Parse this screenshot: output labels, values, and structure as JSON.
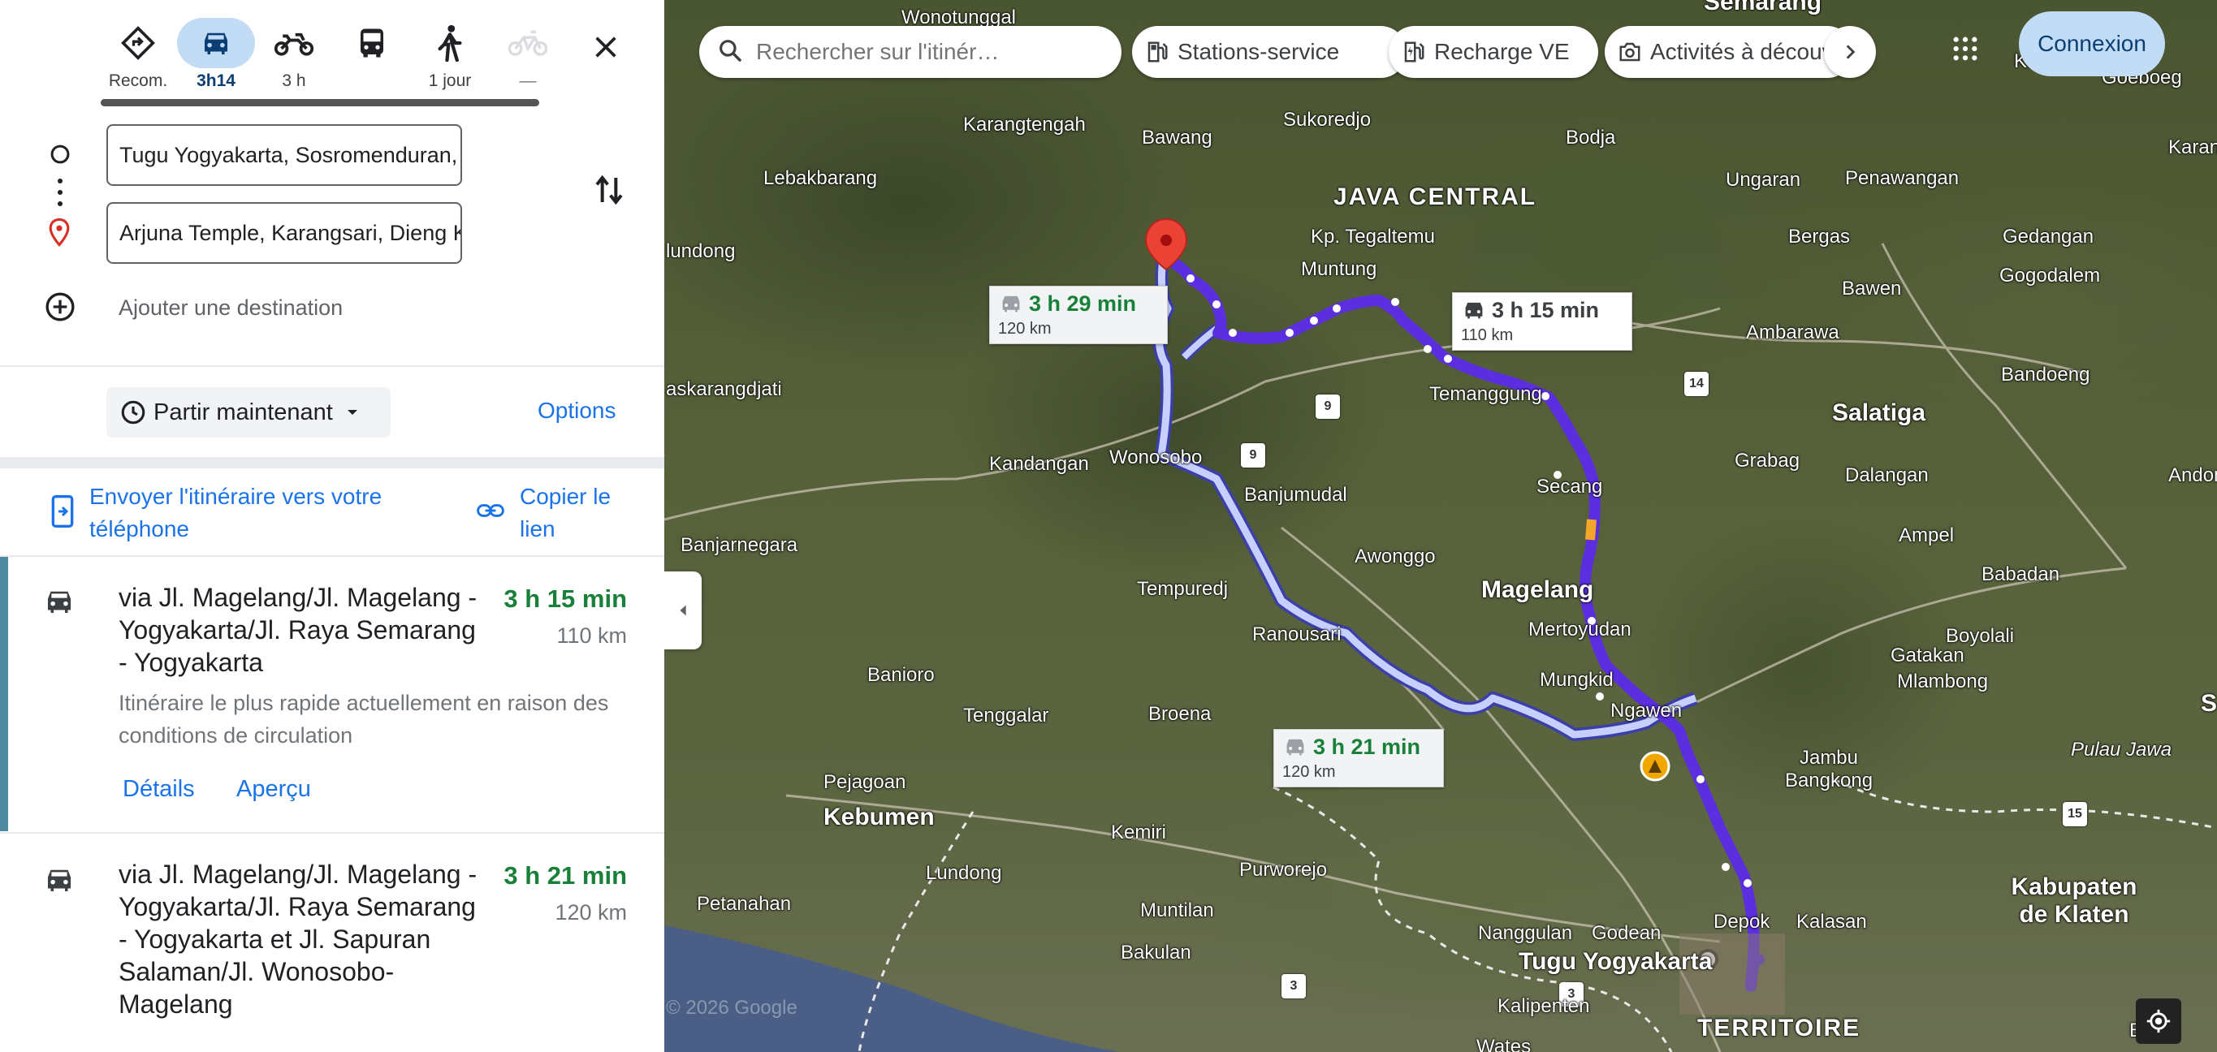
{
  "modes": [
    {
      "name": "recommended",
      "label": "Recom."
    },
    {
      "name": "car",
      "label": "3h14",
      "active": true
    },
    {
      "name": "motorbike",
      "label": "3 h"
    },
    {
      "name": "transit",
      "label": ""
    },
    {
      "name": "walk",
      "label": "1 jour"
    },
    {
      "name": "bicycle",
      "label": "—"
    }
  ],
  "waypoints": {
    "origin": "Tugu Yogyakarta, Sosromenduran, Gedongtengen",
    "destination": "Arjuna Temple, Karangsari, Dieng Kulon, Banjarnegara",
    "add_destination": "Ajouter une destination"
  },
  "depart": {
    "label": "Partir maintenant",
    "options": "Options"
  },
  "share": {
    "send_to_phone": "Envoyer l'itinéraire vers votre téléphone",
    "copy_link": "Copier le lien"
  },
  "routes": [
    {
      "title": "via Jl. Magelang/Jl. Magelang - Yogyakarta/Jl. Raya Semarang - Yogyakarta",
      "time": "3 h 15 min",
      "distance": "110 km",
      "description": "Itinéraire le plus rapide actuellement en raison des conditions de circulation",
      "details": "Détails",
      "preview": "Aperçu"
    },
    {
      "title": "via Jl. Magelang/Jl. Magelang - Yogyakarta/Jl. Raya Semarang - Yogyakarta et Jl. Sapuran Salaman/Jl. Wonosobo-Magelang",
      "time": "3 h 21 min",
      "distance": "120 km"
    }
  ],
  "map": {
    "search_placeholder": "Rechercher sur l'itinéraire",
    "search_value": "Rechercher sur l'itinér…",
    "chips": [
      "Stations-service",
      "Recharge VE",
      "Activités à découvrir"
    ],
    "sign_in": "Connexion",
    "copyright": "© 2026 Google",
    "route_labels": [
      {
        "time": "3 h 29 min",
        "distance": "120 km"
      },
      {
        "time": "3 h 15 min",
        "distance": "110 km"
      },
      {
        "time": "3 h 21 min",
        "distance": "120 km"
      }
    ],
    "places": [
      {
        "text": "Semarang",
        "cls": "big"
      },
      {
        "text": "Wonotunggal",
        "cls": ""
      },
      {
        "text": "Karangawen",
        "cls": ""
      },
      {
        "text": "Goeboeg",
        "cls": ""
      },
      {
        "text": "Karangtengah",
        "cls": ""
      },
      {
        "text": "Bawang",
        "cls": ""
      },
      {
        "text": "Sukoredjo",
        "cls": ""
      },
      {
        "text": "Bodja",
        "cls": ""
      },
      {
        "text": "Karangr",
        "cls": ""
      },
      {
        "text": "Lebakbarang",
        "cls": ""
      },
      {
        "text": "JAVA CENTRAL",
        "cls": "region"
      },
      {
        "text": "Ungaran",
        "cls": ""
      },
      {
        "text": "Penawangan",
        "cls": ""
      },
      {
        "text": "lundong",
        "cls": ""
      },
      {
        "text": "Kp. Tegaltemu",
        "cls": ""
      },
      {
        "text": "Bergas",
        "cls": ""
      },
      {
        "text": "Gedangan",
        "cls": ""
      },
      {
        "text": "Muntung",
        "cls": ""
      },
      {
        "text": "Gogodalem",
        "cls": ""
      },
      {
        "text": "Bawen",
        "cls": ""
      },
      {
        "text": "Ambarawa",
        "cls": ""
      },
      {
        "text": "Bandoeng",
        "cls": ""
      },
      {
        "text": "askarangdjati",
        "cls": ""
      },
      {
        "text": "Temanggung",
        "cls": ""
      },
      {
        "text": "Salatiga",
        "cls": "big"
      },
      {
        "text": "Kandangan",
        "cls": ""
      },
      {
        "text": "Wonosobo",
        "cls": ""
      },
      {
        "text": "Grabag",
        "cls": ""
      },
      {
        "text": "Dalangan",
        "cls": ""
      },
      {
        "text": "Andong",
        "cls": ""
      },
      {
        "text": "Secang",
        "cls": ""
      },
      {
        "text": "Banjumudal",
        "cls": ""
      },
      {
        "text": "Banjarnegara",
        "cls": ""
      },
      {
        "text": "Ampel",
        "cls": ""
      },
      {
        "text": "Awonggo",
        "cls": ""
      },
      {
        "text": "Babadan",
        "cls": ""
      },
      {
        "text": "Magelang",
        "cls": "big"
      },
      {
        "text": "Tempuredj",
        "cls": ""
      },
      {
        "text": "Mertoyudan",
        "cls": ""
      },
      {
        "text": "Boyolali",
        "cls": ""
      },
      {
        "text": "Ranousari",
        "cls": ""
      },
      {
        "text": "Gatakan",
        "cls": ""
      },
      {
        "text": "Banioro",
        "cls": ""
      },
      {
        "text": "Mungkid",
        "cls": ""
      },
      {
        "text": "Mlambong",
        "cls": ""
      },
      {
        "text": "Tenggalar",
        "cls": ""
      },
      {
        "text": "Broena",
        "cls": ""
      },
      {
        "text": "Ngawen",
        "cls": ""
      },
      {
        "text": "Pulau Jawa",
        "cls": "ital"
      },
      {
        "text": "Pejagoan",
        "cls": ""
      },
      {
        "text": "Kebumen",
        "cls": "big"
      },
      {
        "text": "Jambu Bangkong",
        "cls": ""
      },
      {
        "text": "Kemiri",
        "cls": ""
      },
      {
        "text": "Lundong",
        "cls": ""
      },
      {
        "text": "Purworejo",
        "cls": ""
      },
      {
        "text": "Kabupaten de Klaten",
        "cls": "big"
      },
      {
        "text": "Petanahan",
        "cls": ""
      },
      {
        "text": "Muntilan",
        "cls": ""
      },
      {
        "text": "Depok",
        "cls": ""
      },
      {
        "text": "Kalasan",
        "cls": ""
      },
      {
        "text": "Nanggulan",
        "cls": ""
      },
      {
        "text": "Godean",
        "cls": ""
      },
      {
        "text": "Bakulan",
        "cls": ""
      },
      {
        "text": "Tugu Yogyakarta",
        "cls": "big"
      },
      {
        "text": "Kalipenten",
        "cls": ""
      },
      {
        "text": "TERRITOIRE",
        "cls": "region"
      },
      {
        "text": "Wates",
        "cls": ""
      },
      {
        "text": "Bend",
        "cls": ""
      },
      {
        "text": "S",
        "cls": "big"
      }
    ],
    "shields": [
      "9",
      "9",
      "14",
      "15",
      "3",
      "3"
    ]
  },
  "colors": {
    "primary_route": "#5b2ee0",
    "alt_route": "#b8c4ff",
    "link": "#1a73e8",
    "time_green": "#188038"
  }
}
